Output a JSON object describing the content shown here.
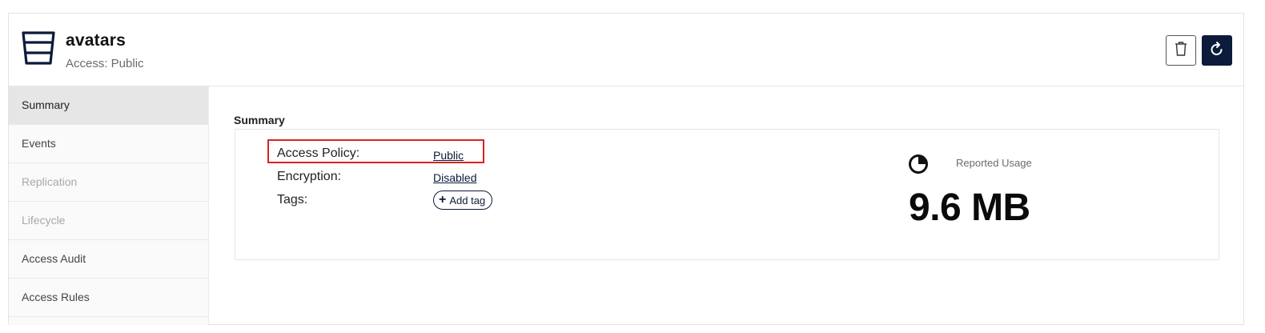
{
  "bucket": {
    "name": "avatars",
    "access_text": "Access: Public"
  },
  "actions": {
    "delete_icon": "trash-icon",
    "refresh_icon": "refresh-icon"
  },
  "sidebar": {
    "items": [
      {
        "label": "Summary",
        "state": "active"
      },
      {
        "label": "Events",
        "state": "enabled"
      },
      {
        "label": "Replication",
        "state": "disabled"
      },
      {
        "label": "Lifecycle",
        "state": "disabled"
      },
      {
        "label": "Access Audit",
        "state": "enabled"
      },
      {
        "label": "Access Rules",
        "state": "enabled"
      }
    ]
  },
  "summary": {
    "title": "Summary",
    "access_policy_label": "Access Policy:",
    "access_policy_value": "Public",
    "encryption_label": "Encryption:",
    "encryption_value": "Disabled",
    "tags_label": "Tags:",
    "add_tag_label": "Add tag",
    "usage_label": "Reported Usage",
    "usage_value": "9.6 MB"
  },
  "colors": {
    "primary": "#0c1b3a",
    "highlight": "#e02020"
  }
}
